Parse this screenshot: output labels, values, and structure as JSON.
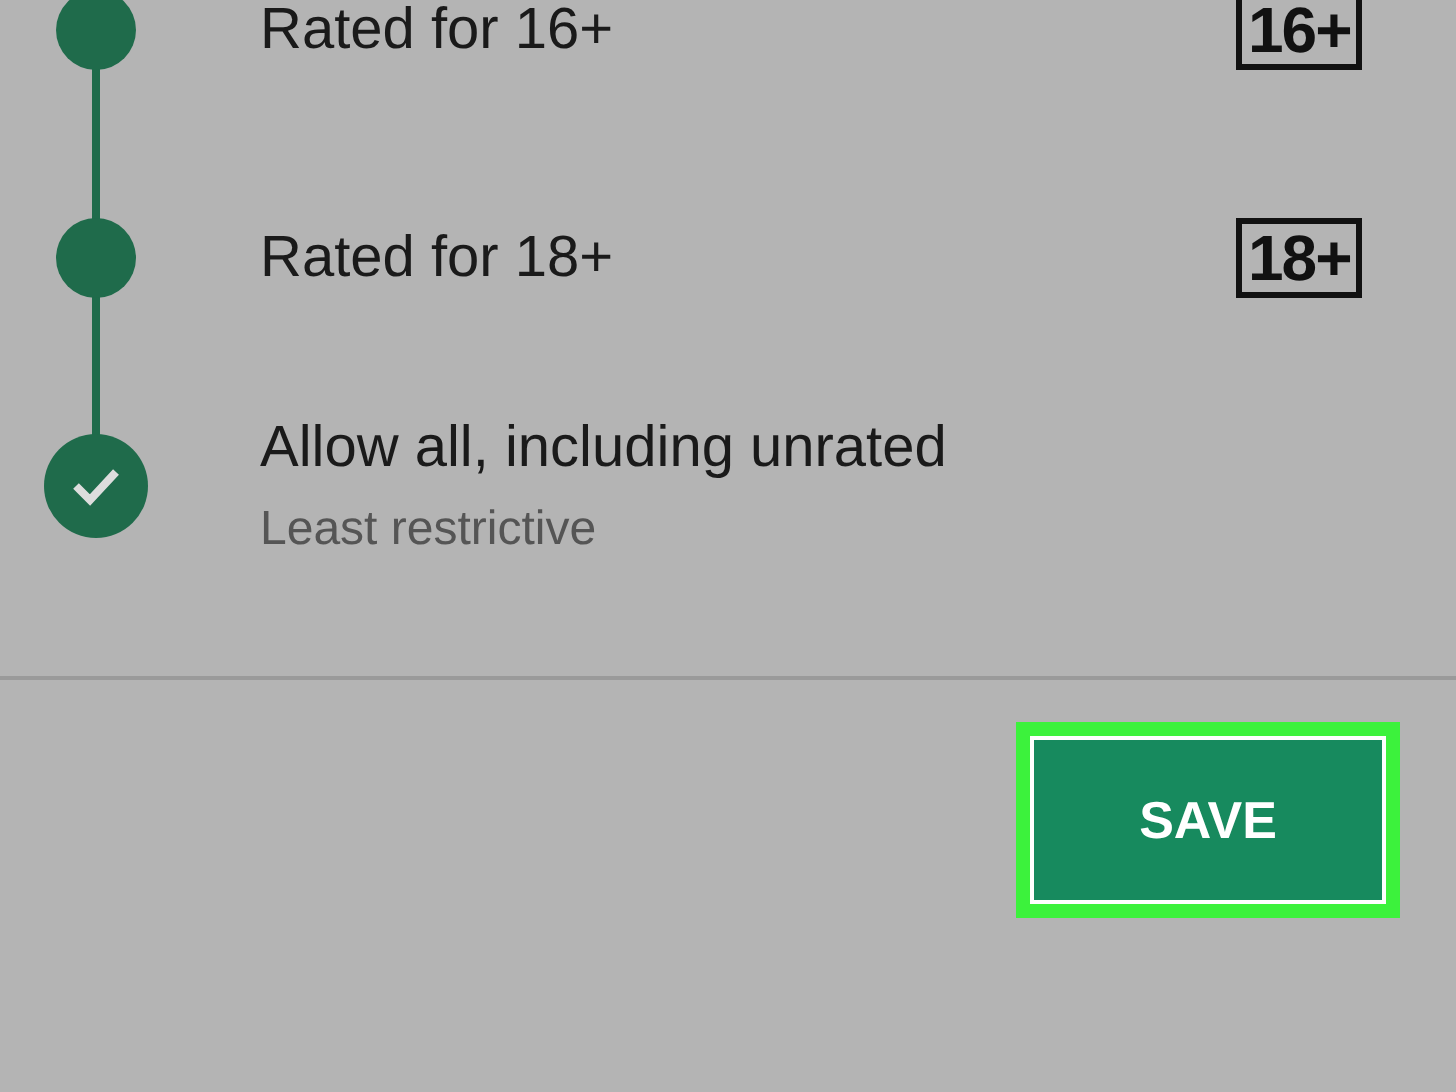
{
  "options": [
    {
      "title": "Rated for 16+",
      "badge": "16+",
      "selected": false
    },
    {
      "title": "Rated for 18+",
      "badge": "18+",
      "selected": false
    },
    {
      "title": "Allow all, including unrated",
      "subtitle": "Least restrictive",
      "selected": true
    }
  ],
  "save_button": "SAVE"
}
